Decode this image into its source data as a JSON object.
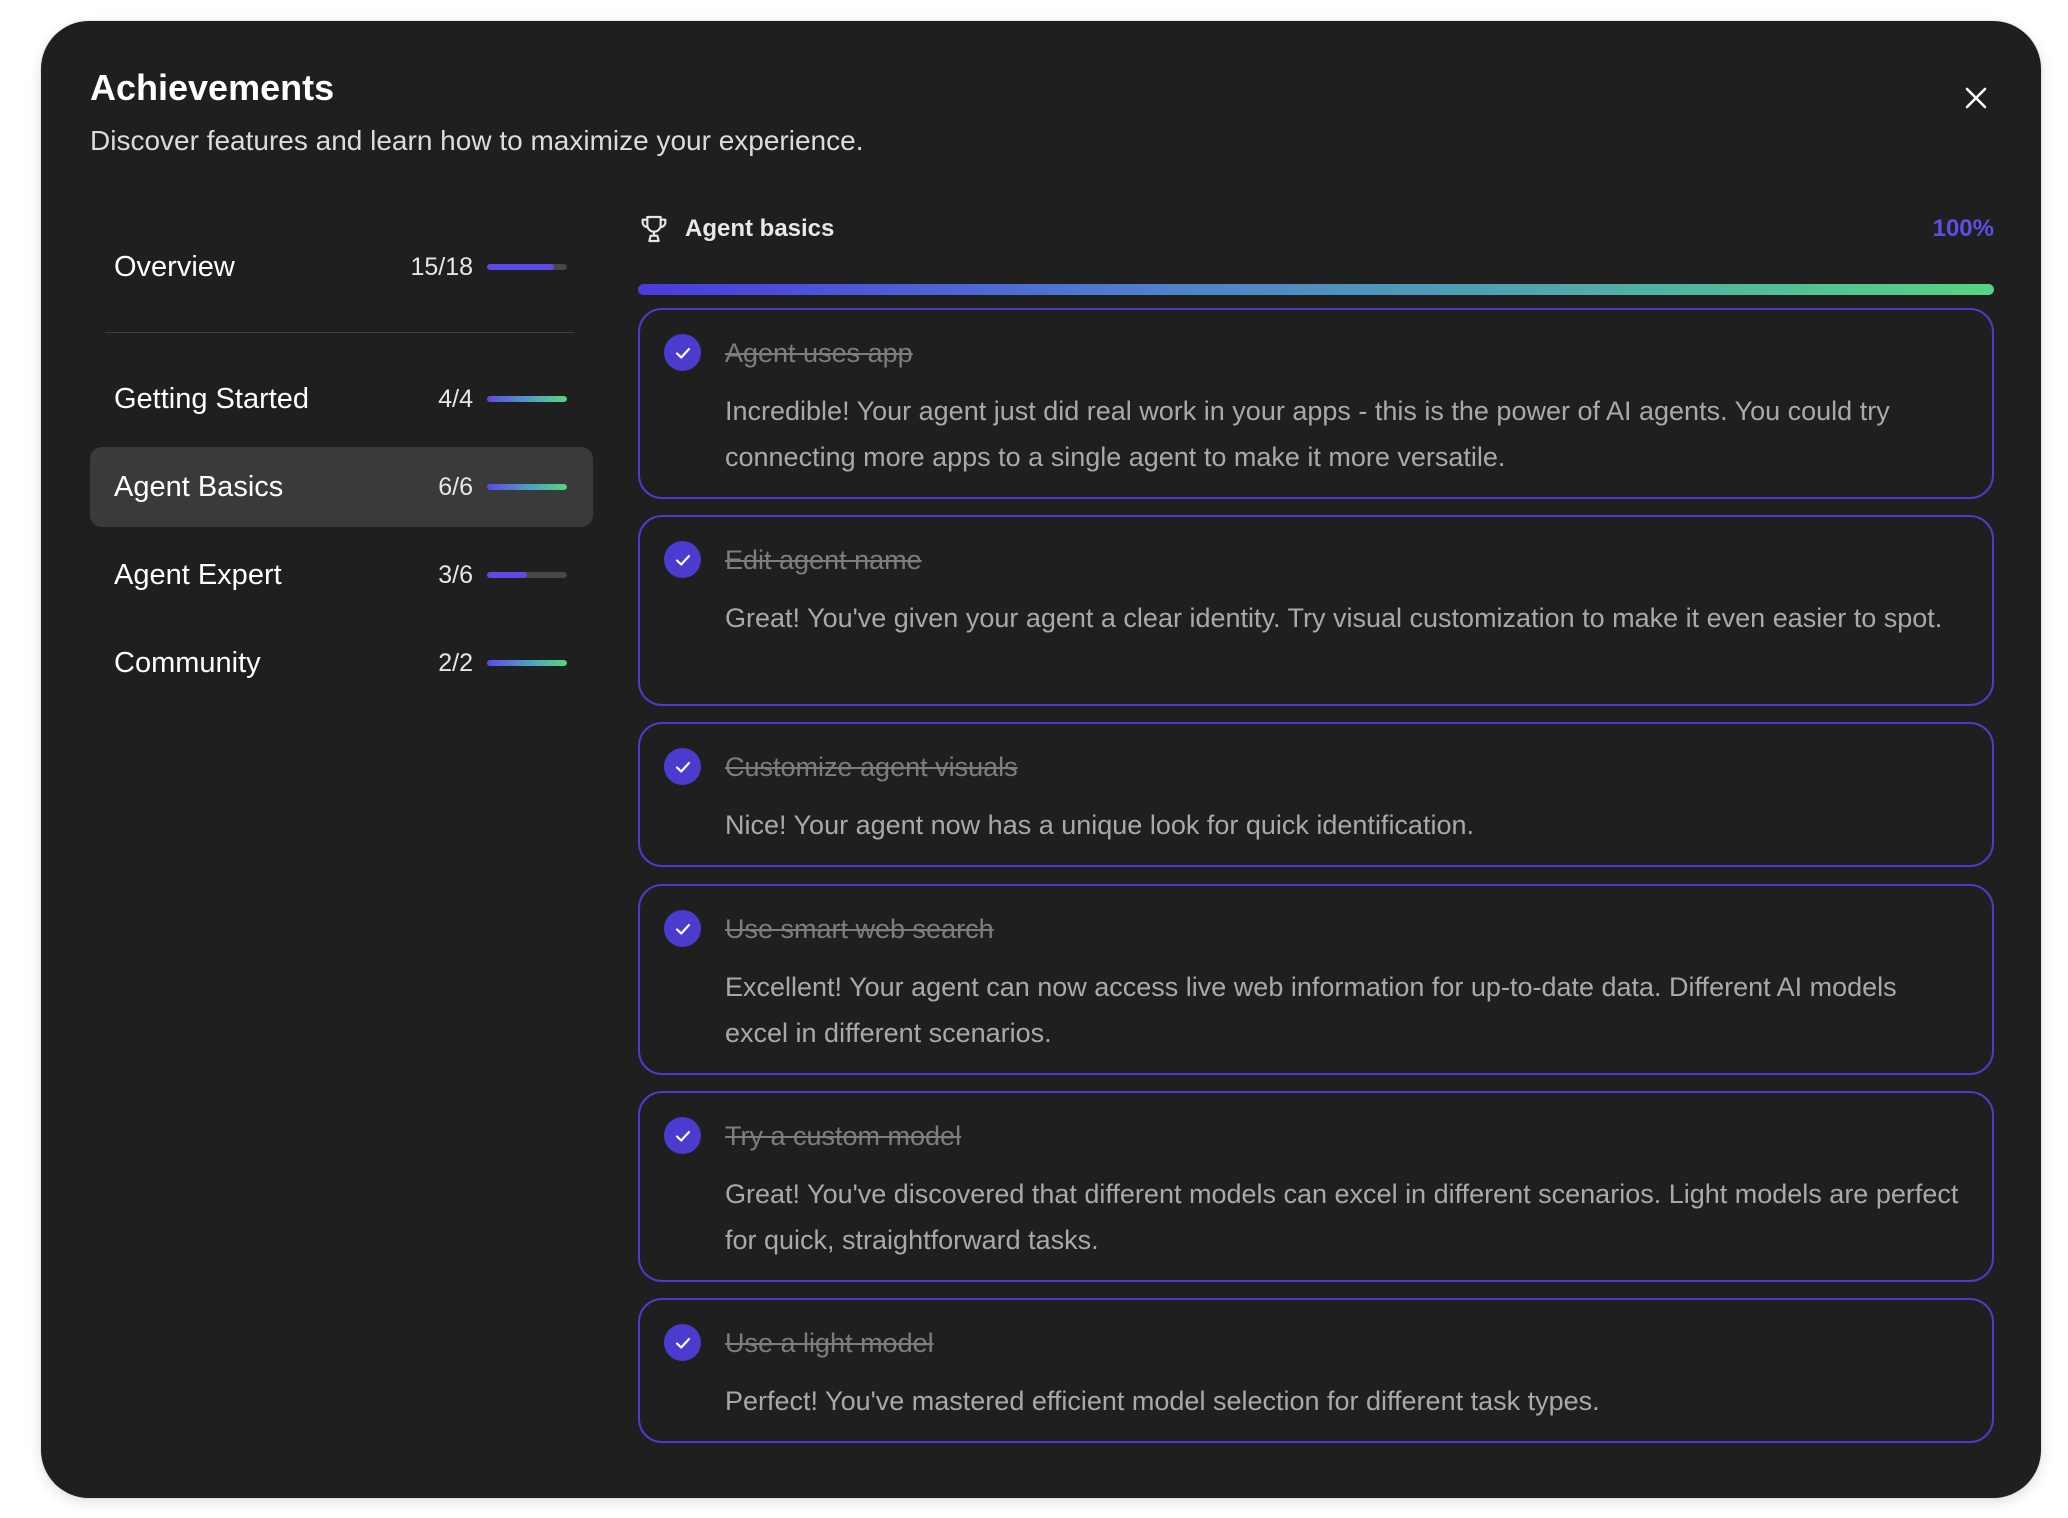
{
  "header": {
    "title": "Achievements",
    "subtitle": "Discover features and learn how to maximize your experience."
  },
  "sidebar": {
    "overview": {
      "label": "Overview",
      "count": "15/18",
      "progress": 0.833
    },
    "items": [
      {
        "label": "Getting Started",
        "count": "4/4",
        "progress": 1.0,
        "active": false
      },
      {
        "label": "Agent Basics",
        "count": "6/6",
        "progress": 1.0,
        "active": true
      },
      {
        "label": "Agent Expert",
        "count": "3/6",
        "progress": 0.5,
        "active": false
      },
      {
        "label": "Community",
        "count": "2/2",
        "progress": 1.0,
        "active": false
      }
    ]
  },
  "section": {
    "icon": "trophy-icon",
    "title": "Agent basics",
    "percent": "100%",
    "progress": 1.0
  },
  "achievements": [
    {
      "title": "Agent uses app",
      "description": "Incredible! Your agent just did real work in your apps - this is the power of AI agents. You could try connecting more apps to a single agent to make it more versatile.",
      "completed": true
    },
    {
      "title": "Edit agent name",
      "description": "Great! You've given your agent a clear identity. Try visual customization to make it even easier to spot.",
      "completed": true
    },
    {
      "title": "Customize agent visuals",
      "description": "Nice! Your agent now has a unique look for quick identification.",
      "completed": true
    },
    {
      "title": "Use smart web search",
      "description": "Excellent! Your agent can now access live web information for up-to-date data. Different AI models excel in different scenarios.",
      "completed": true
    },
    {
      "title": "Try a custom model",
      "description": "Great! You've discovered that different models can excel in different scenarios. Light models are perfect for quick, straightforward tasks.",
      "completed": true
    },
    {
      "title": "Use a light model",
      "description": "Perfect! You've mastered efficient model selection for different task types.",
      "completed": true
    }
  ],
  "colors": {
    "background": "#1f1f1f",
    "accent": "#5b4ae6",
    "card_border": "#4a3ccc",
    "success": "#57d584"
  }
}
